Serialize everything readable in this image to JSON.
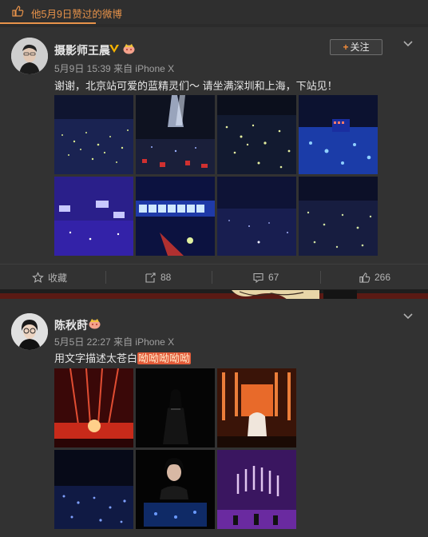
{
  "header": {
    "label": "他5月9日赞过的微博",
    "icon": "thumbs-up-icon",
    "accent": "#e8934a"
  },
  "posts": [
    {
      "username": "摄影师王晨",
      "verified": true,
      "follow_label": "关注",
      "timestamp": "5月9日 15:39",
      "source_prefix": "来自",
      "source": "iPhone X",
      "text": "谢谢，北京站可爱的蓝精灵们～ 请坐满深圳和上海，下站见！",
      "photo_count": 8,
      "actions": {
        "favorite_label": "收藏",
        "repost_count": "88",
        "comment_count": "67",
        "like_count": "266"
      }
    },
    {
      "username": "陈秋莳",
      "verified": false,
      "timestamp": "5月5日 22:27",
      "source_prefix": "来自",
      "source": "iPhone X",
      "text": "用文字描述太苍白",
      "emoji_text": "呦呦呦呦呦",
      "photo_count": 6
    }
  ],
  "colors": {
    "background": "#2b2b2b",
    "card": "#323232",
    "highlight": "#e35c3a"
  }
}
